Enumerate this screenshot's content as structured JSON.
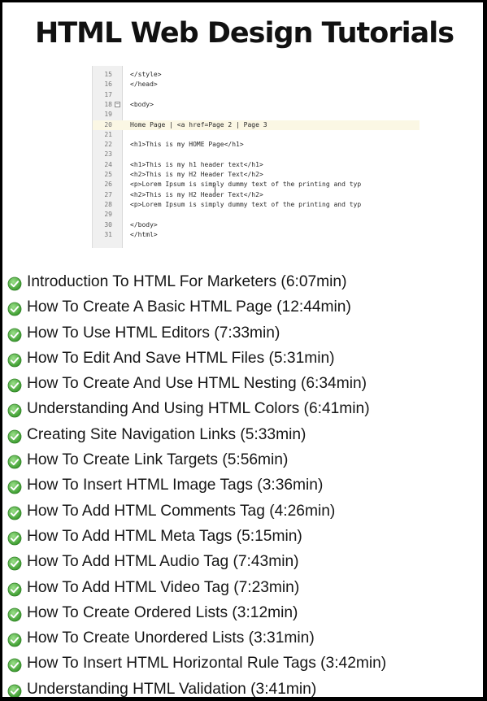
{
  "title": "HTML Web Design Tutorials",
  "code_editor": {
    "lines": [
      {
        "num": "15",
        "text": "</style>",
        "fold": ""
      },
      {
        "num": "16",
        "text": "</head>",
        "fold": ""
      },
      {
        "num": "17",
        "text": "",
        "fold": ""
      },
      {
        "num": "18",
        "text": "<body>",
        "fold": "−"
      },
      {
        "num": "19",
        "text": "",
        "fold": ""
      },
      {
        "num": "20",
        "text": "Home Page | <a href=Page 2 | Page 3",
        "fold": ""
      },
      {
        "num": "21",
        "text": "",
        "fold": ""
      },
      {
        "num": "22",
        "text": "<h1>This is my HOME Page</h1>",
        "fold": ""
      },
      {
        "num": "23",
        "text": "",
        "fold": ""
      },
      {
        "num": "24",
        "text": "<h1>This is my h1 header text</h1>",
        "fold": ""
      },
      {
        "num": "25",
        "text": "<h2>This is my H2 Header Text</h2>",
        "fold": ""
      },
      {
        "num": "26",
        "text": "<p>Lorem Ipsum is simply dummy text of the printing and typ",
        "fold": ""
      },
      {
        "num": "27",
        "text": "<h2>This is my H2 Header Text</h2>",
        "fold": ""
      },
      {
        "num": "28",
        "text": "<p>Lorem Ipsum is simply dummy text of the printing and typ",
        "fold": ""
      },
      {
        "num": "29",
        "text": "",
        "fold": ""
      },
      {
        "num": "30",
        "text": "</body>",
        "fold": ""
      },
      {
        "num": "31",
        "text": "</html>",
        "fold": ""
      }
    ],
    "highlighted_line": "20"
  },
  "tutorials": [
    {
      "label": "Introduction To HTML For Marketers (6:07min)",
      "icon": "check-circle-icon"
    },
    {
      "label": "How To Create A Basic HTML Page (12:44min)",
      "icon": "check-circle-icon"
    },
    {
      "label": "How To Use HTML Editors (7:33min)",
      "icon": "check-circle-icon"
    },
    {
      "label": "How To Edit And Save HTML Files (5:31min)",
      "icon": "check-circle-icon"
    },
    {
      "label": "How To Create And Use HTML Nesting (6:34min)",
      "icon": "check-circle-icon"
    },
    {
      "label": "Understanding And Using HTML Colors (6:41min)",
      "icon": "check-circle-icon"
    },
    {
      "label": "Creating Site Navigation Links (5:33min)",
      "icon": "check-circle-icon"
    },
    {
      "label": "How To Create Link Targets (5:56min)",
      "icon": "check-circle-icon"
    },
    {
      "label": "How To Insert HTML Image Tags (3:36min)",
      "icon": "check-circle-icon"
    },
    {
      "label": "How To Add HTML Comments Tag (4:26min)",
      "icon": "check-circle-icon"
    },
    {
      "label": "How To Add HTML Meta Tags (5:15min)",
      "icon": "check-circle-icon"
    },
    {
      "label": "How To Add HTML Audio Tag (7:43min)",
      "icon": "check-circle-icon"
    },
    {
      "label": "How To Add HTML Video Tag (7:23min)",
      "icon": "check-circle-icon"
    },
    {
      "label": "How To Create Ordered Lists (3:12min)",
      "icon": "check-circle-icon"
    },
    {
      "label": "How To Create Unordered Lists (3:31min)",
      "icon": "check-circle-icon"
    },
    {
      "label": "How To Insert HTML Horizontal Rule Tags (3:42min)",
      "icon": "check-circle-icon"
    },
    {
      "label": "Understanding HTML Validation (3:41min)",
      "icon": "check-circle-icon"
    }
  ],
  "colors": {
    "check_green_light": "#9be08a",
    "check_green_dark": "#3b9b2e",
    "code_highlight": "#fbf7e4",
    "border": "#000000"
  }
}
